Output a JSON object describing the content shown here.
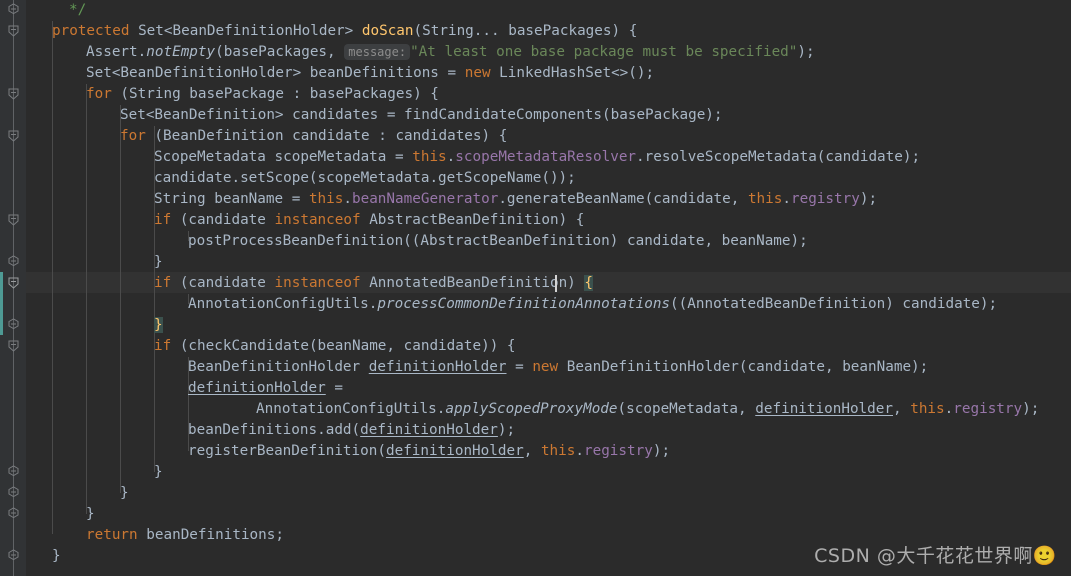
{
  "editor": {
    "theme_name": "darcula",
    "background": "#2b2b2b",
    "gutter_background": "#313335",
    "caret_line_background": "#323232",
    "accent_keyword": "#cc7832",
    "accent_string": "#6a8759",
    "accent_comment": "#629755",
    "accent_field": "#9876aa",
    "accent_method": "#ffc66d",
    "accent_text": "#a9b7c6",
    "changebar_color": "#4e9a94",
    "brace_match_background": "#3b514d",
    "language": "Java",
    "caret_line_number": 14
  },
  "inlay_hints": {
    "message_param": "message:"
  },
  "watermark": {
    "text": "CSDN @大千花花世界啊🙂"
  },
  "code_lines": [
    {
      "n": 1,
      "indent": 3,
      "text": "*/"
    },
    {
      "n": 2,
      "indent": 2,
      "text": "protected Set<BeanDefinitionHolder> doScan(String... basePackages) {"
    },
    {
      "n": 3,
      "indent": 3,
      "text": "Assert.notEmpty(basePackages, message: \"At least one base package must be specified\");"
    },
    {
      "n": 4,
      "indent": 3,
      "text": "Set<BeanDefinitionHolder> beanDefinitions = new LinkedHashSet<>();"
    },
    {
      "n": 5,
      "indent": 3,
      "text": "for (String basePackage : basePackages) {"
    },
    {
      "n": 6,
      "indent": 4,
      "text": "Set<BeanDefinition> candidates = findCandidateComponents(basePackage);"
    },
    {
      "n": 7,
      "indent": 4,
      "text": "for (BeanDefinition candidate : candidates) {"
    },
    {
      "n": 8,
      "indent": 5,
      "text": "ScopeMetadata scopeMetadata = this.scopeMetadataResolver.resolveScopeMetadata(candidate);"
    },
    {
      "n": 9,
      "indent": 5,
      "text": "candidate.setScope(scopeMetadata.getScopeName());"
    },
    {
      "n": 10,
      "indent": 5,
      "text": "String beanName = this.beanNameGenerator.generateBeanName(candidate, this.registry);"
    },
    {
      "n": 11,
      "indent": 5,
      "text": "if (candidate instanceof AbstractBeanDefinition) {"
    },
    {
      "n": 12,
      "indent": 6,
      "text": "postProcessBeanDefinition((AbstractBeanDefinition) candidate, beanName);"
    },
    {
      "n": 13,
      "indent": 5,
      "text": "}"
    },
    {
      "n": 14,
      "indent": 5,
      "text": "if (candidate instanceof AnnotatedBeanDefinition) {"
    },
    {
      "n": 15,
      "indent": 6,
      "text": "AnnotationConfigUtils.processCommonDefinitionAnnotations((AnnotatedBeanDefinition) candidate);"
    },
    {
      "n": 16,
      "indent": 5,
      "text": "}"
    },
    {
      "n": 17,
      "indent": 5,
      "text": "if (checkCandidate(beanName, candidate)) {"
    },
    {
      "n": 18,
      "indent": 6,
      "text": "BeanDefinitionHolder definitionHolder = new BeanDefinitionHolder(candidate, beanName);"
    },
    {
      "n": 19,
      "indent": 6,
      "text": "definitionHolder ="
    },
    {
      "n": 20,
      "indent": 8,
      "text": "AnnotationConfigUtils.applyScopedProxyMode(scopeMetadata, definitionHolder, this.registry);"
    },
    {
      "n": 21,
      "indent": 6,
      "text": "beanDefinitions.add(definitionHolder);"
    },
    {
      "n": 22,
      "indent": 6,
      "text": "registerBeanDefinition(definitionHolder, this.registry);"
    },
    {
      "n": 23,
      "indent": 5,
      "text": "}"
    },
    {
      "n": 24,
      "indent": 4,
      "text": "}"
    },
    {
      "n": 25,
      "indent": 3,
      "text": "}"
    },
    {
      "n": 26,
      "indent": 3,
      "text": "return beanDefinitions;"
    },
    {
      "n": 27,
      "indent": 2,
      "text": "}"
    }
  ],
  "fold_markers": [
    {
      "row": 1,
      "kind": "fold-end"
    },
    {
      "row": 2,
      "kind": "fold-open"
    },
    {
      "row": 5,
      "kind": "fold-open"
    },
    {
      "row": 7,
      "kind": "fold-open"
    },
    {
      "row": 11,
      "kind": "fold-open"
    },
    {
      "row": 13,
      "kind": "fold-end"
    },
    {
      "row": 14,
      "kind": "fold-open"
    },
    {
      "row": 16,
      "kind": "fold-end"
    },
    {
      "row": 17,
      "kind": "fold-open"
    },
    {
      "row": 23,
      "kind": "fold-end"
    },
    {
      "row": 24,
      "kind": "fold-end"
    },
    {
      "row": 25,
      "kind": "fold-end"
    },
    {
      "row": 27,
      "kind": "fold-end"
    }
  ]
}
